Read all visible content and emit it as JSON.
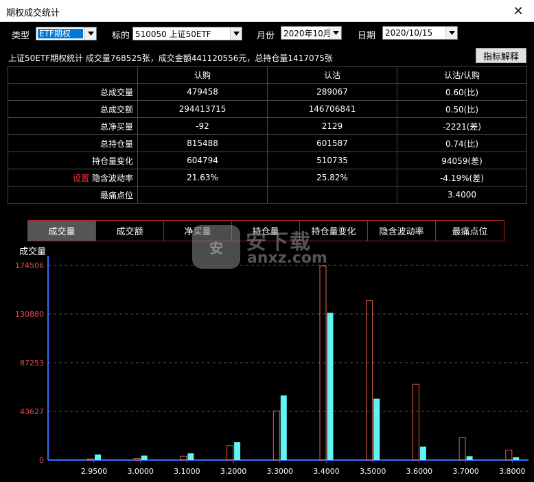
{
  "window": {
    "title": "期权成交统计"
  },
  "filters": {
    "type_label": "类型",
    "type_value": "ETF期权",
    "underlying_label": "标的",
    "underlying_value": "510050 上证50ETF",
    "month_label": "月份",
    "month_value": "2020年10月",
    "date_label": "日期",
    "date_value": "2020/10/15"
  },
  "summary": "上证50ETF期权统计 成交量768525张，成交金额441120556元，总持仓量1417075张",
  "explain_button": "指标解释",
  "table": {
    "headers": [
      "",
      "认购",
      "认沽",
      "认沽/认购"
    ],
    "rows": [
      {
        "label": "总成交量",
        "call": "479458",
        "put": "289067",
        "ratio": "0.60(比)"
      },
      {
        "label": "总成交额",
        "call": "294413715",
        "put": "146706841",
        "ratio": "0.50(比)"
      },
      {
        "label": "总净买量",
        "call": "-92",
        "put": "2129",
        "ratio": "-2221(差)"
      },
      {
        "label": "总持仓量",
        "call": "815488",
        "put": "601587",
        "ratio": "0.74(比)"
      },
      {
        "label": "持仓量变化",
        "call": "604794",
        "put": "510735",
        "ratio": "94059(差)"
      },
      {
        "label": "隐含波动率",
        "setting": "设置",
        "call": "21.63%",
        "put": "25.82%",
        "ratio": "-4.19%(差)"
      },
      {
        "label": "最痛点位",
        "call": "",
        "put": "",
        "ratio": "3.4000"
      }
    ]
  },
  "tabs": [
    {
      "label": "成交量",
      "active": true
    },
    {
      "label": "成交额",
      "active": false
    },
    {
      "label": "净买量",
      "active": false
    },
    {
      "label": "持仓量",
      "active": false
    },
    {
      "label": "持仓量变化",
      "active": false
    },
    {
      "label": "隐含波动率",
      "active": false
    },
    {
      "label": "最痛点位",
      "active": false
    }
  ],
  "watermark": {
    "brand": "安下载",
    "domain": "anxz.com",
    "logo_text": "安"
  },
  "colors": {
    "call": "#e8644a",
    "put": "#5ff5f5",
    "axis": "#2f6fff",
    "ytick": "#e05050",
    "grid": "#555555"
  },
  "chart_data": {
    "type": "bar",
    "ylabel": "成交量",
    "categories": [
      "2.9500",
      "3.0000",
      "3.1000",
      "3.2000",
      "3.3000",
      "3.4000",
      "3.5000",
      "3.6000",
      "3.7000",
      "3.8000"
    ],
    "y_ticks": [
      "0",
      "43627",
      "87253",
      "130880",
      "174506"
    ],
    "ylim": [
      0,
      174506
    ],
    "grid": true,
    "series": [
      {
        "style": "outline",
        "color": "#e8644a",
        "values": [
          1000,
          1500,
          3500,
          13000,
          44000,
          174000,
          143000,
          68000,
          20000,
          9000
        ]
      },
      {
        "style": "filled",
        "color": "#5ff5f5",
        "values": [
          5000,
          4000,
          6000,
          16000,
          58000,
          132000,
          55000,
          12000,
          3500,
          2500
        ]
      }
    ]
  }
}
